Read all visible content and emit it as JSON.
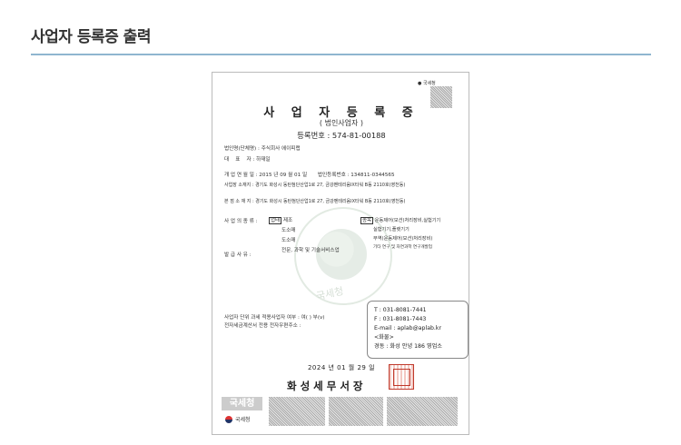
{
  "page_title": "사업자 등록증 출력",
  "certificate": {
    "qr_label": "국세청",
    "title": "사 업 자 등 록 증",
    "subtitle": "( 법인사업자 )",
    "reg_number": "등록번호 : 574-81-00188",
    "fields": [
      {
        "label": "법인명(단체명) :",
        "value": "주식회사 에이피랩"
      },
      {
        "label": "대    표    자 :",
        "value": "하재일"
      },
      {
        "label": "개 업 연 월 일 :",
        "value": "2015 년 09 월 01 일",
        "extra_label": "법인등록번호 :",
        "extra_value": "134811-0344565"
      },
      {
        "label": "사업장 소재지 :",
        "value": "경기도 화성시 동탄첨단산업1로 27, 금강펜테리움IX타워 B동 2110호(영천동)"
      },
      {
        "label": "본 점 소 재 지 :",
        "value": "경기도 화성시 동탄첨단산업1로 27, 금강펜테리움IX타워 B동 2110호(영천동)"
      }
    ],
    "business": {
      "label": "사 업 의  종 류 :",
      "type_badge": "업태",
      "item_badge": "종목",
      "types": [
        "제조",
        "도소매",
        "도소매",
        "전문, 과학 및 기술서비스업"
      ],
      "items": [
        "운동제어(모션)처리장비,실험기기",
        "실험기기,플랫기기",
        "무역(운동제어(모션)처리장비)",
        "기타 연구 및 자연과학 연구개발업"
      ]
    },
    "issue_reason_label": "발  급  사  유 :",
    "tax_line1": "사업자 단위 과세 적용사업자 여부 : 여( ) 부(v)",
    "tax_line2": "전자세금계산서 전용 전자우편주소 :",
    "contact": {
      "phone": "T : 031-8081-7441",
      "fax": "F : 031-8081-7443",
      "email": "E-mail : aplab@aplab.kr",
      "note": "<화물>",
      "branch": "경동 : 화성 안녕 186 영업소"
    },
    "date": "2024 년 01 월 29 일",
    "office": "화성세무서장",
    "seal_watermark_text": "국세청",
    "footer_box_text": "국세청",
    "footer_logo_label": "국세청"
  }
}
